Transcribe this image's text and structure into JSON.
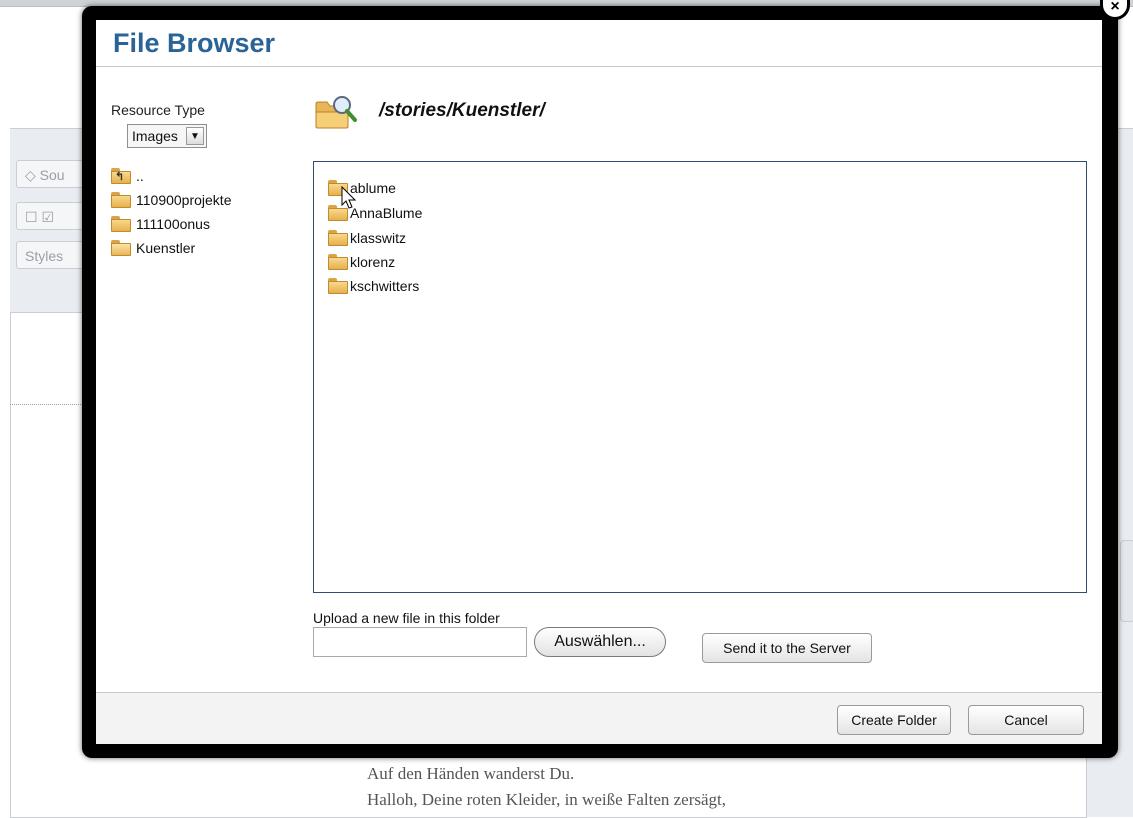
{
  "background": {
    "toolbar": {
      "source_label": "Sou",
      "styles_label": "Styles"
    },
    "content_lines": [
      "Auf den Händen wanderst Du.",
      "Halloh, Deine roten Kleider, in weiße Falten zersägt,"
    ]
  },
  "dialog": {
    "title": "File Browser",
    "close_icon": "close-icon",
    "resource_type": {
      "label": "Resource Type",
      "selected": "Images"
    },
    "folder_tree": [
      {
        "label": "..",
        "icon": "folder-up-icon"
      },
      {
        "label": "110900projekte",
        "icon": "folder-icon"
      },
      {
        "label": "111100onus",
        "icon": "folder-icon"
      },
      {
        "label": "Kuenstler",
        "icon": "folder-open-icon"
      }
    ],
    "current_path": "/stories/Kuenstler/",
    "files": [
      {
        "label": "ablume",
        "icon": "folder-icon"
      },
      {
        "label": "AnnaBlume",
        "icon": "folder-icon"
      },
      {
        "label": "klasswitz",
        "icon": "folder-icon"
      },
      {
        "label": "klorenz",
        "icon": "folder-icon"
      },
      {
        "label": "kschwitters",
        "icon": "folder-icon"
      }
    ],
    "upload": {
      "label": "Upload a new file in this folder",
      "choose_label": "Auswählen...",
      "send_label": "Send it to the Server"
    },
    "footer": {
      "create_folder_label": "Create Folder",
      "cancel_label": "Cancel"
    }
  },
  "colors": {
    "title": "#2a6496",
    "frame": "#000000",
    "folder": "#e7b04e"
  }
}
